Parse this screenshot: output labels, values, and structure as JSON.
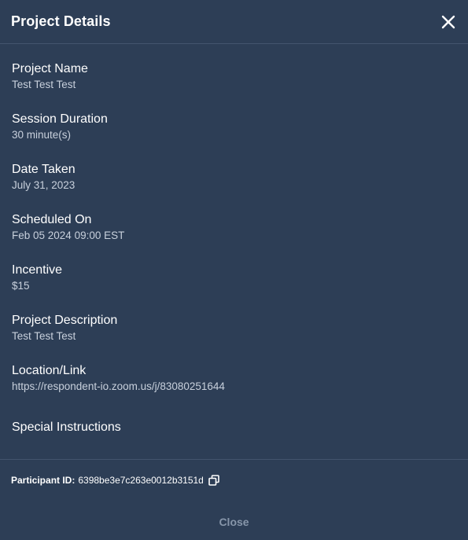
{
  "header": {
    "title": "Project Details",
    "close_icon": "close-icon"
  },
  "fields": [
    {
      "label": "Project Name",
      "value": "Test Test Test"
    },
    {
      "label": "Session Duration",
      "value": "30 minute(s)"
    },
    {
      "label": "Date Taken",
      "value": "July 31, 2023"
    },
    {
      "label": "Scheduled On",
      "value": "Feb 05 2024 09:00 EST"
    },
    {
      "label": "Incentive",
      "value": "$15"
    },
    {
      "label": "Project Description",
      "value": "Test Test Test"
    },
    {
      "label": "Location/Link",
      "value": "https://respondent-io.zoom.us/j/83080251644"
    },
    {
      "label": "Special Instructions",
      "value": ""
    }
  ],
  "participant": {
    "label": "Participant ID:",
    "value": "6398be3e7c263e0012b3151d",
    "copy_icon": "copy-icon"
  },
  "footer": {
    "close_label": "Close"
  },
  "colors": {
    "background": "#2d3e56",
    "divider": "#43546d",
    "label": "#ffffff",
    "value": "#c8d0dc",
    "footer_button": "#8796aa"
  }
}
